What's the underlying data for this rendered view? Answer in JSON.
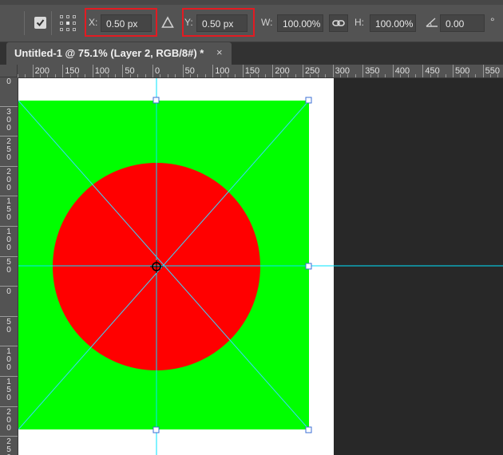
{
  "options_bar": {
    "x_label": "X:",
    "x_value": "0.50 px",
    "y_label": "Y:",
    "y_value": "0.50 px",
    "w_label": "W:",
    "w_value": "100.00%",
    "h_label": "H:",
    "h_value": "100.00%",
    "angle_value": "0.00",
    "degree_symbol": "°",
    "highlight_color": "#e21b22"
  },
  "tab": {
    "title": "Untitled-1 @ 75.1% (Layer 2, RGB/8#) *",
    "close": "×"
  },
  "h_ruler": [
    "0",
    "200",
    "150",
    "100",
    "50",
    "0",
    "50",
    "100",
    "150",
    "200",
    "250",
    "300",
    "350",
    "400",
    "450",
    "500",
    "550"
  ],
  "v_ruler": [
    "0",
    "3\n0\n0",
    "2\n5\n0",
    "2\n0\n0",
    "1\n5\n0",
    "1\n0\n0",
    "5\n0",
    "0",
    "5\n0",
    "1\n0\n0",
    "1\n5\n0",
    "2\n0\n0",
    "2\n5\n0"
  ],
  "colors": {
    "layer_fill": "#00ff00",
    "circle_fill": "#ff0000",
    "guide": "#00e5ff",
    "document_bg": "#ffffff"
  },
  "icons": {
    "commit": "checkbox-icon",
    "reference_point": "reference-point-icon",
    "interpolation": "triangle-icon",
    "link": "link-icon",
    "angle": "angle-icon"
  }
}
